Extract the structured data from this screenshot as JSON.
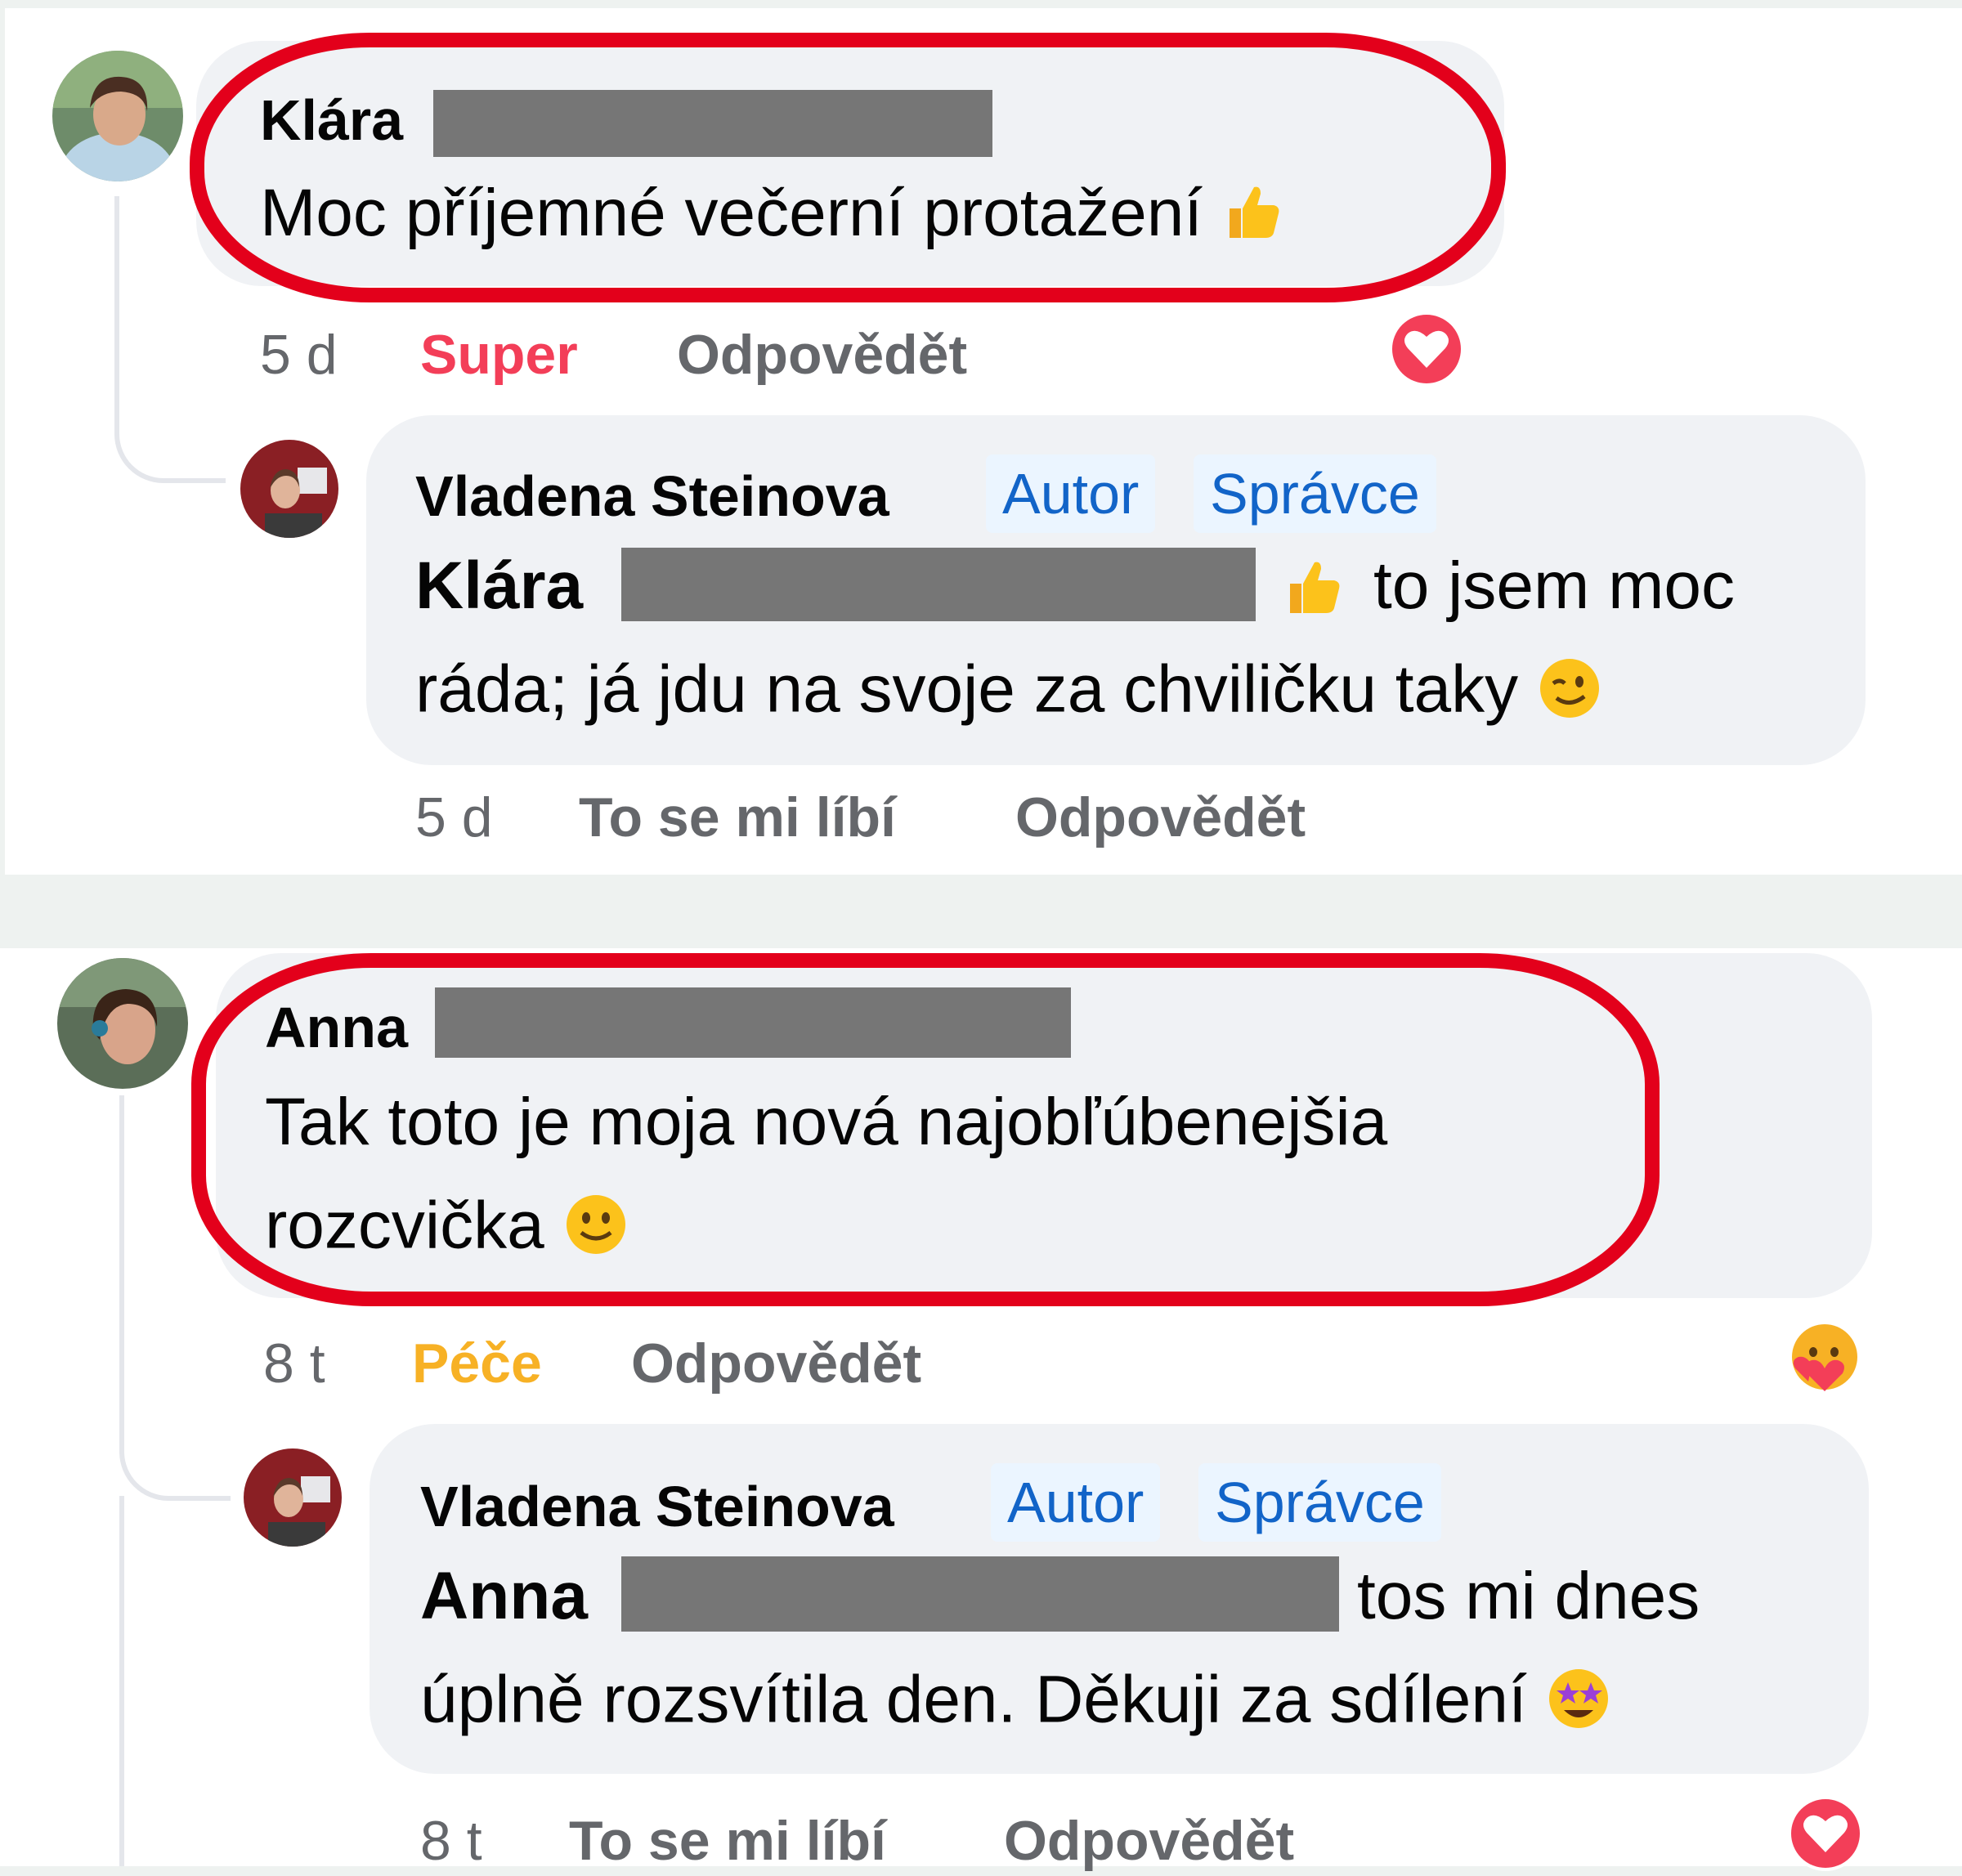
{
  "comments": [
    {
      "author": "Klára",
      "text": "Moc příjemné večerní protažení",
      "emoji": "thumbs-up",
      "meta": {
        "time": "5 d",
        "reaction_label": "Super",
        "reply_label": "Odpovědět"
      },
      "reaction_icon": "heart-reaction-icon",
      "reply": {
        "author": "Vladena Steinova",
        "badges": [
          "Autor",
          "Správce"
        ],
        "mention": "Klára",
        "text_line1": "to jsem moc",
        "text_line2": "ráda; já jdu na svoje za chviličku taky",
        "emoji": "wink",
        "meta": {
          "time": "5 d",
          "like_label": "To se mi líbí",
          "reply_label": "Odpovědět"
        }
      }
    },
    {
      "author": "Anna",
      "text_line1": "Tak toto je moja nová najobľúbenejšia",
      "text_line2": "rozcvička",
      "emoji": "smile",
      "meta": {
        "time": "8 t",
        "reaction_label": "Péče",
        "reply_label": "Odpovědět"
      },
      "reaction_icon": "care-reaction-icon",
      "reply": {
        "author": "Vladena Steinova",
        "badges": [
          "Autor",
          "Správce"
        ],
        "mention": "Anna",
        "text_line1": "tos mi dnes",
        "text_line2": "úplně rozsvítila den. Děkuji za sdílení",
        "emoji": "star-struck",
        "meta": {
          "time": "8 t",
          "like_label": "To se mi líbí",
          "reply_label": "Odpovědět"
        },
        "reaction_icon": "heart-reaction-icon"
      }
    }
  ],
  "colors": {
    "highlight": "#e3001b",
    "bubble": "#f0f2f5",
    "badge_text": "#1264c8",
    "super_reaction": "#f33e58",
    "pece_reaction": "#f7b125",
    "meta_gray": "#65676b"
  }
}
